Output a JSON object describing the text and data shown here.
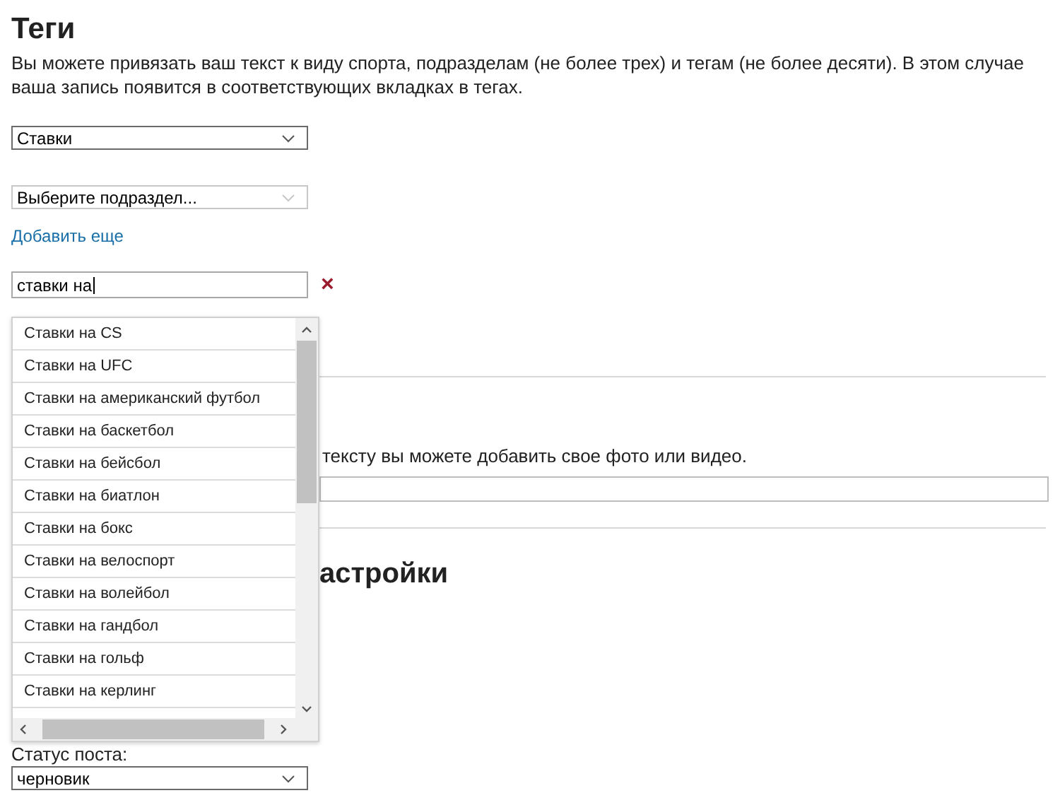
{
  "title": "Теги",
  "intro": "Вы можете привязать ваш текст к виду спорта, подразделам (не более трех) и тегам (не более десяти). В этом случае ваша запись появится в соответствующих вкладках в тегах.",
  "sport_select": {
    "value": "Ставки"
  },
  "subsection_select": {
    "value": "Выберите подраздел...",
    "disabled": true
  },
  "add_more_link": "Добавить еще",
  "tag_input": {
    "value": "ставки на"
  },
  "remove_mark": "×",
  "suggestions": [
    {
      "label": "Ставки на CS"
    },
    {
      "label": "Ставки на UFC"
    },
    {
      "label": "Ставки на американский футбол"
    },
    {
      "label": "Ставки на баскетбол"
    },
    {
      "label": "Ставки на бейсбол"
    },
    {
      "label": "Ставки на биатлон"
    },
    {
      "label": "Ставки на бокс"
    },
    {
      "label": "Ставки на велоспорт"
    },
    {
      "label": "Ставки на волейбол"
    },
    {
      "label": "Ставки на гандбол"
    },
    {
      "label": "Ставки на гольф"
    },
    {
      "label": "Ставки на керлинг"
    }
  ],
  "media_text": "тексту вы можете добавить свое фото или видео.",
  "settings_heading": "астройки",
  "status_label": "Статус поста:",
  "status_select": {
    "value": "черновик"
  }
}
